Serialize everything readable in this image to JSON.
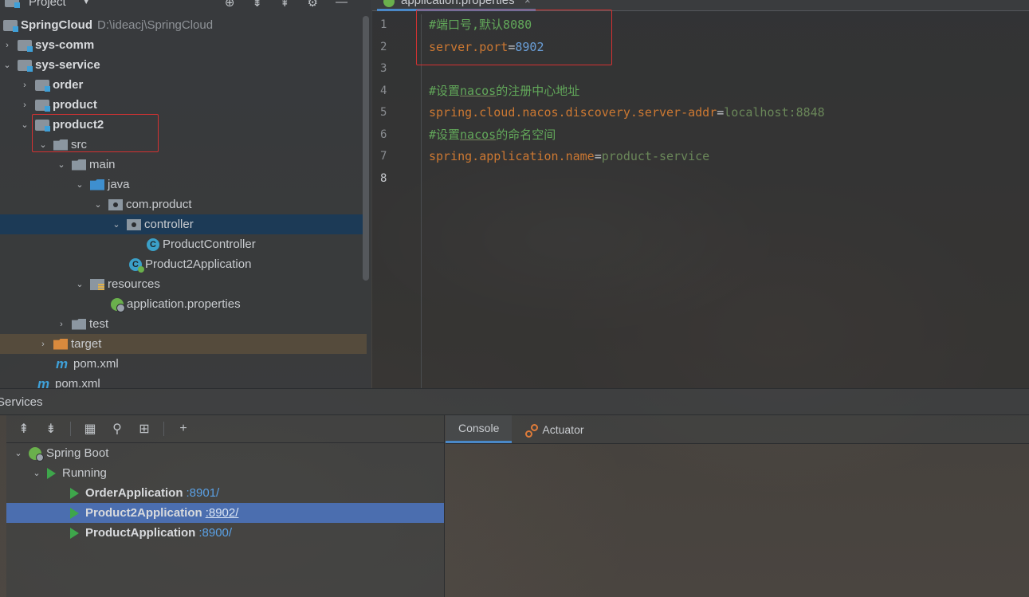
{
  "project_panel": {
    "title": "Project",
    "root": {
      "name": "SpringCloud",
      "path": "D:\\ideacj\\SpringCloud"
    },
    "tree": [
      {
        "label": "sys-comm",
        "chevron": "›"
      },
      {
        "label": "sys-service",
        "chevron": "⌄"
      },
      {
        "label": "order",
        "chevron": "›"
      },
      {
        "label": "product",
        "chevron": "›"
      },
      {
        "label": "product2",
        "chevron": "⌄"
      },
      {
        "label": "src",
        "chevron": "⌄"
      },
      {
        "label": "main",
        "chevron": "⌄"
      },
      {
        "label": "java",
        "chevron": "⌄"
      },
      {
        "label": "com.product",
        "chevron": "⌄"
      },
      {
        "label": "controller",
        "chevron": "⌄"
      },
      {
        "label": "ProductController",
        "icon_letter": "C"
      },
      {
        "label": "Product2Application",
        "icon_letter": "C"
      },
      {
        "label": "resources",
        "chevron": "⌄"
      },
      {
        "label": "application.properties"
      },
      {
        "label": "test",
        "chevron": "›"
      },
      {
        "label": "target",
        "chevron": "›"
      },
      {
        "label": "pom.xml",
        "icon_letter": "m"
      },
      {
        "label": "pom.xml",
        "icon_letter": "m"
      }
    ]
  },
  "editor": {
    "tab_label": "application.properties",
    "close_glyph": "×",
    "line_numbers": [
      "1",
      "2",
      "3",
      "4",
      "5",
      "6",
      "7",
      "8"
    ],
    "lines": [
      {
        "comment": "#端口号,默认8080"
      },
      {
        "key": "server.port",
        "eq": "=",
        "value": "8902"
      },
      {},
      {
        "comment_prefix": "#设置",
        "comment_under": "nacos",
        "comment_suffix": "的注册中心地址"
      },
      {
        "key": "spring.cloud.nacos.discovery.server-addr",
        "eq": "=",
        "value": "localhost:8848"
      },
      {
        "comment_prefix": "#设置",
        "comment_under": "nacos",
        "comment_suffix": "的命名空间"
      },
      {
        "key": "spring.application.name",
        "eq": "=",
        "value": "product-service"
      },
      {}
    ]
  },
  "services": {
    "title": "Services",
    "toolbar_glyphs": [
      "⇞",
      "⇟",
      "▦",
      "⚲",
      "⊞",
      "+"
    ],
    "spring_boot_label": "Spring Boot",
    "running_label": "Running",
    "apps": [
      {
        "name": "OrderApplication",
        "port": ":8901/"
      },
      {
        "name": "Product2Application",
        "port": ":8902/"
      },
      {
        "name": "ProductApplication",
        "port": ":8900/"
      }
    ],
    "tabs": {
      "console": "Console",
      "actuator": "Actuator"
    }
  }
}
